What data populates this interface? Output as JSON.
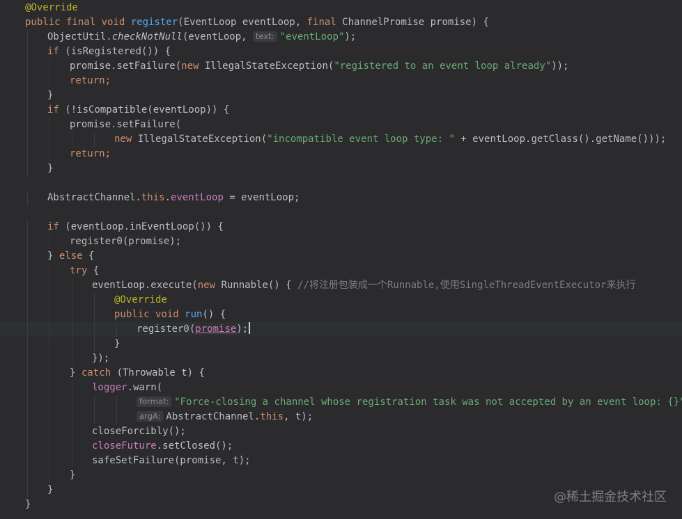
{
  "colors": {
    "background": "#2b2b2d",
    "keyword": "#cf8e6d",
    "annotation": "#bbb529",
    "method_decl": "#56a8f5",
    "string": "#6aab73",
    "field": "#c77dbb",
    "comment": "#7a7e85",
    "text": "#bcbec4"
  },
  "watermark": "@稀土掘金技术社区",
  "code_lines": [
    {
      "indent": 4,
      "tokens": [
        {
          "t": "@Override",
          "c": "annotation"
        }
      ]
    },
    {
      "indent": 4,
      "tokens": [
        {
          "t": "public final void ",
          "c": "keyword"
        },
        {
          "t": "register",
          "c": "method_decl"
        },
        {
          "t": "(EventLoop eventLoop, ",
          "c": "text"
        },
        {
          "t": "final ",
          "c": "keyword"
        },
        {
          "t": "ChannelPromise promise) {",
          "c": "text"
        }
      ]
    },
    {
      "indent": 8,
      "tokens": [
        {
          "t": "ObjectUtil.",
          "c": "text"
        },
        {
          "t": "checkNotNull",
          "c": "italic"
        },
        {
          "t": "(eventLoop, ",
          "c": "text"
        },
        {
          "hint": "text:"
        },
        {
          "t": "\"eventLoop\"",
          "c": "string"
        },
        {
          "t": ");",
          "c": "text"
        }
      ]
    },
    {
      "indent": 8,
      "tokens": [
        {
          "t": "if ",
          "c": "keyword"
        },
        {
          "t": "(isRegistered()) {",
          "c": "text"
        }
      ]
    },
    {
      "indent": 12,
      "tokens": [
        {
          "t": "promise.setFailure(",
          "c": "text"
        },
        {
          "t": "new ",
          "c": "keyword"
        },
        {
          "t": "IllegalStateException(",
          "c": "text"
        },
        {
          "t": "\"registered to an event loop already\"",
          "c": "string"
        },
        {
          "t": "));",
          "c": "text"
        }
      ]
    },
    {
      "indent": 12,
      "tokens": [
        {
          "t": "return;",
          "c": "keyword"
        }
      ]
    },
    {
      "indent": 8,
      "tokens": [
        {
          "t": "}",
          "c": "text"
        }
      ]
    },
    {
      "indent": 8,
      "tokens": [
        {
          "t": "if ",
          "c": "keyword"
        },
        {
          "t": "(!isCompatible(eventLoop)) {",
          "c": "text"
        }
      ]
    },
    {
      "indent": 12,
      "tokens": [
        {
          "t": "promise.setFailure(",
          "c": "text"
        }
      ]
    },
    {
      "indent": 20,
      "tokens": [
        {
          "t": "new ",
          "c": "keyword"
        },
        {
          "t": "IllegalStateException(",
          "c": "text"
        },
        {
          "t": "\"incompatible event loop type: \"",
          "c": "string"
        },
        {
          "t": " + eventLoop.getClass().getName()));",
          "c": "text"
        }
      ]
    },
    {
      "indent": 12,
      "tokens": [
        {
          "t": "return;",
          "c": "keyword"
        }
      ]
    },
    {
      "indent": 8,
      "tokens": [
        {
          "t": "}",
          "c": "text"
        }
      ]
    },
    {
      "indent": 0,
      "tokens": []
    },
    {
      "indent": 8,
      "tokens": [
        {
          "t": "AbstractChannel.",
          "c": "text"
        },
        {
          "t": "this",
          "c": "keyword"
        },
        {
          "t": ".",
          "c": "text"
        },
        {
          "t": "eventLoop",
          "c": "field"
        },
        {
          "t": " = eventLoop;",
          "c": "text"
        }
      ]
    },
    {
      "indent": 0,
      "tokens": []
    },
    {
      "indent": 8,
      "tokens": [
        {
          "t": "if ",
          "c": "keyword"
        },
        {
          "t": "(eventLoop.inEventLoop()) {",
          "c": "text"
        }
      ]
    },
    {
      "indent": 12,
      "tokens": [
        {
          "t": "register0(promise);",
          "c": "text"
        }
      ]
    },
    {
      "indent": 8,
      "tokens": [
        {
          "t": "} ",
          "c": "text"
        },
        {
          "t": "else ",
          "c": "keyword"
        },
        {
          "t": "{",
          "c": "text"
        }
      ]
    },
    {
      "indent": 12,
      "tokens": [
        {
          "t": "try ",
          "c": "keyword"
        },
        {
          "t": "{",
          "c": "text"
        }
      ]
    },
    {
      "indent": 16,
      "tokens": [
        {
          "t": "eventLoop.execute(",
          "c": "text"
        },
        {
          "t": "new ",
          "c": "keyword"
        },
        {
          "t": "Runnable() { ",
          "c": "text"
        },
        {
          "t": "//将注册包装成一个Runnable,使用SingleThreadEventExecutor来执行",
          "c": "comment"
        }
      ]
    },
    {
      "indent": 20,
      "tokens": [
        {
          "t": "@Override",
          "c": "annotation"
        }
      ]
    },
    {
      "indent": 20,
      "tokens": [
        {
          "t": "public void ",
          "c": "keyword"
        },
        {
          "t": "run",
          "c": "method_decl"
        },
        {
          "t": "() {",
          "c": "text"
        }
      ]
    },
    {
      "indent": 24,
      "current": true,
      "tokens": [
        {
          "t": "register0(",
          "c": "text"
        },
        {
          "t": "promise",
          "c": "field_underline"
        },
        {
          "t": ");",
          "c": "text"
        },
        {
          "caret": true
        }
      ]
    },
    {
      "indent": 20,
      "tokens": [
        {
          "t": "}",
          "c": "text"
        }
      ]
    },
    {
      "indent": 16,
      "tokens": [
        {
          "t": "});",
          "c": "text"
        }
      ]
    },
    {
      "indent": 12,
      "tokens": [
        {
          "t": "} ",
          "c": "text"
        },
        {
          "t": "catch ",
          "c": "keyword"
        },
        {
          "t": "(Throwable t) {",
          "c": "text"
        }
      ]
    },
    {
      "indent": 16,
      "tokens": [
        {
          "t": "logger",
          "c": "field"
        },
        {
          "t": ".warn(",
          "c": "text"
        }
      ]
    },
    {
      "indent": 24,
      "tokens": [
        {
          "hint": "format:"
        },
        {
          "t": "\"Force-closing a channel whose registration task was not accepted by an event loop: {}\"",
          "c": "string"
        },
        {
          "t": ",",
          "c": "text"
        }
      ]
    },
    {
      "indent": 24,
      "tokens": [
        {
          "hint": "argA:"
        },
        {
          "t": "AbstractChannel.",
          "c": "text"
        },
        {
          "t": "this",
          "c": "keyword"
        },
        {
          "t": ", t);",
          "c": "text"
        }
      ]
    },
    {
      "indent": 16,
      "tokens": [
        {
          "t": "closeForcibly();",
          "c": "text"
        }
      ]
    },
    {
      "indent": 16,
      "tokens": [
        {
          "t": "closeFuture",
          "c": "field"
        },
        {
          "t": ".setClosed();",
          "c": "text"
        }
      ]
    },
    {
      "indent": 16,
      "tokens": [
        {
          "t": "safeSetFailure(promise, t);",
          "c": "text"
        }
      ]
    },
    {
      "indent": 12,
      "tokens": [
        {
          "t": "}",
          "c": "text"
        }
      ]
    },
    {
      "indent": 8,
      "tokens": [
        {
          "t": "}",
          "c": "text"
        }
      ]
    },
    {
      "indent": 4,
      "tokens": [
        {
          "t": "}",
          "c": "text"
        }
      ]
    }
  ]
}
